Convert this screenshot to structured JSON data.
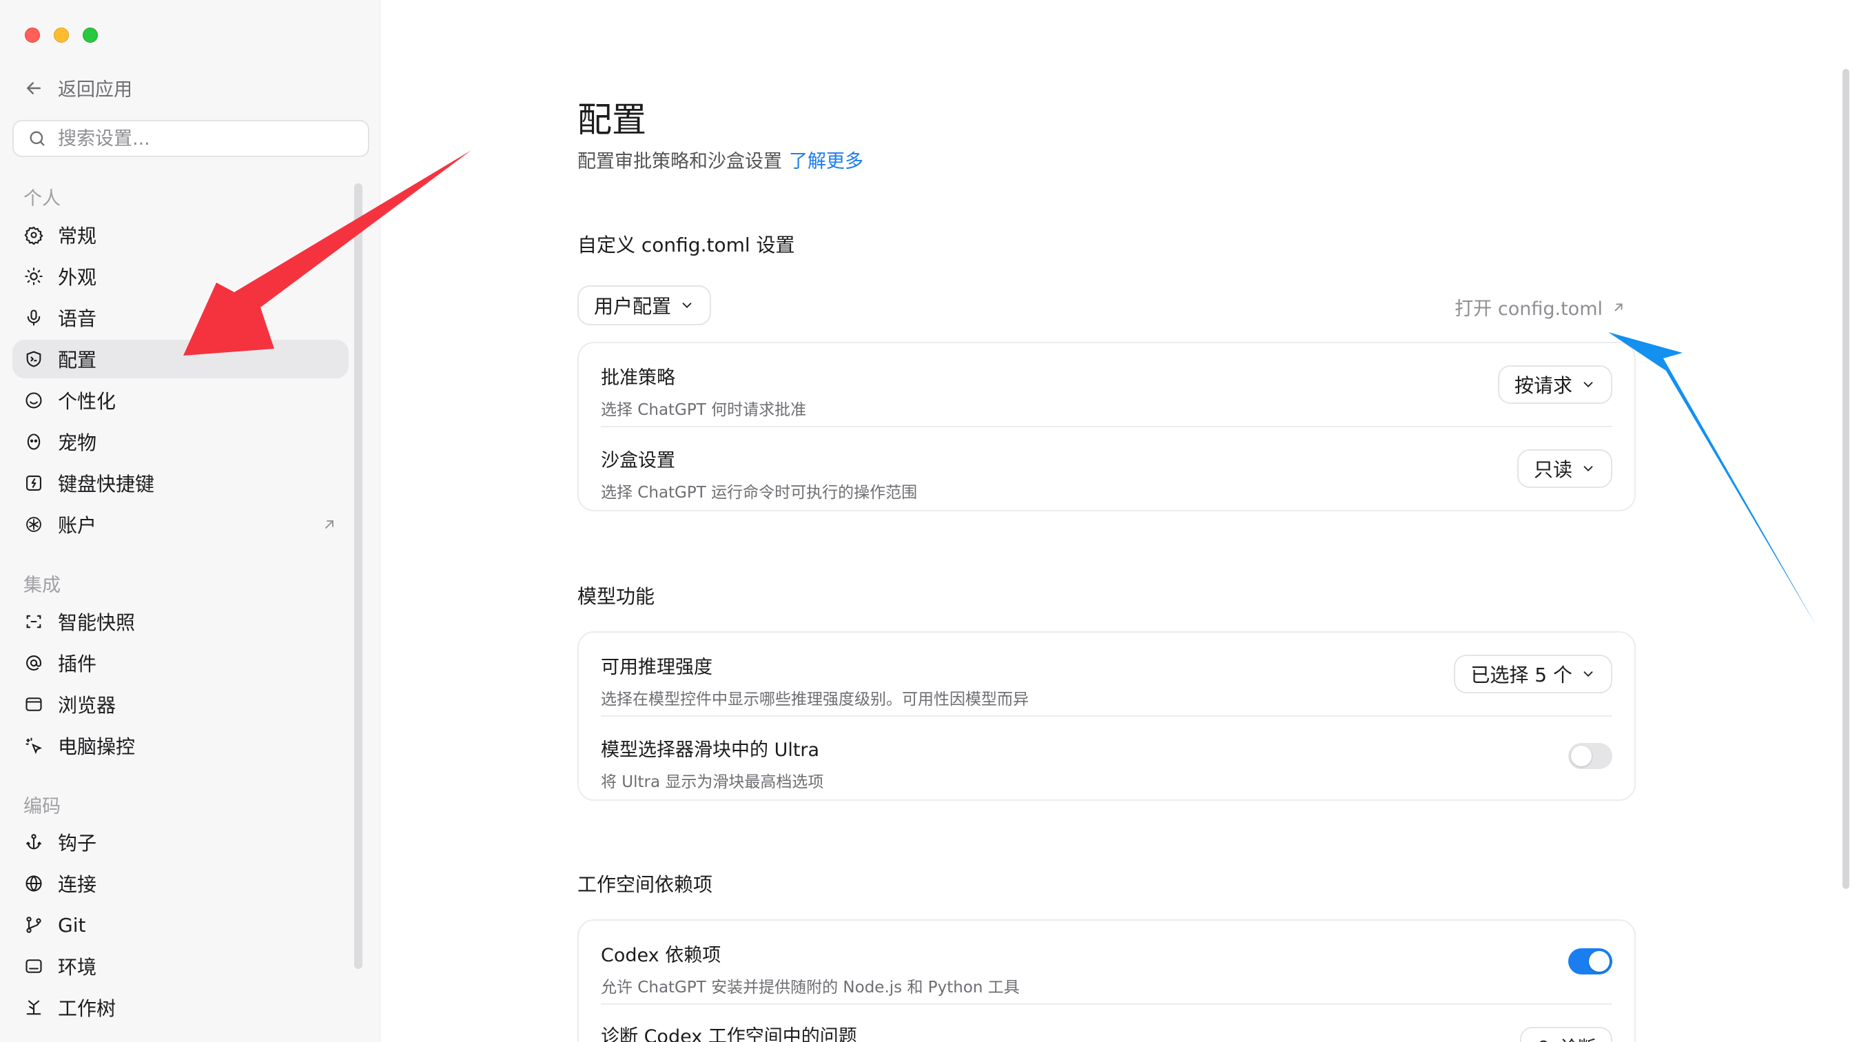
{
  "sidebar": {
    "back_label": "返回应用",
    "search_placeholder": "搜索设置...",
    "sections": {
      "personal": "个人",
      "integrations": "集成",
      "coding": "编码"
    },
    "items": [
      {
        "label": "常规",
        "icon": "gear-icon"
      },
      {
        "label": "外观",
        "icon": "sun-icon"
      },
      {
        "label": "语音",
        "icon": "microphone-icon"
      },
      {
        "label": "配置",
        "icon": "config-shield-icon",
        "active": true
      },
      {
        "label": "个性化",
        "icon": "smile-icon"
      },
      {
        "label": "宠物",
        "icon": "pet-icon"
      },
      {
        "label": "键盘快捷键",
        "icon": "keyboard-shortcut-icon"
      },
      {
        "label": "账户",
        "icon": "openai-icon",
        "external": true
      },
      {
        "label": "智能快照",
        "icon": "snapshot-icon"
      },
      {
        "label": "插件",
        "icon": "plugin-at-icon"
      },
      {
        "label": "浏览器",
        "icon": "browser-icon"
      },
      {
        "label": "电脑操控",
        "icon": "cursor-sparkle-icon"
      },
      {
        "label": "钩子",
        "icon": "anchor-icon"
      },
      {
        "label": "连接",
        "icon": "globe-icon"
      },
      {
        "label": "Git",
        "icon": "git-branch-icon"
      },
      {
        "label": "环境",
        "icon": "terminal-icon"
      },
      {
        "label": "工作树",
        "icon": "worktree-icon"
      }
    ]
  },
  "main": {
    "title": "配置",
    "description": "配置审批策略和沙盒设置",
    "learn_more": "了解更多",
    "custom_section_title": "自定义 config.toml 设置",
    "profile_dropdown": "用户配置",
    "open_config_link": "打开 config.toml",
    "approval": {
      "title": "批准策略",
      "subtitle": "选择 ChatGPT 何时请求批准",
      "value": "按请求"
    },
    "sandbox": {
      "title": "沙盒设置",
      "subtitle": "选择 ChatGPT 运行命令时可执行的操作范围",
      "value": "只读"
    },
    "model_section_title": "模型功能",
    "reasoning": {
      "title": "可用推理强度",
      "subtitle": "选择在模型控件中显示哪些推理强度级别。可用性因模型而异",
      "value": "已选择 5 个"
    },
    "ultra": {
      "title": "模型选择器滑块中的 Ultra",
      "subtitle": "将 Ultra 显示为滑块最高档选项",
      "enabled": false
    },
    "workspace_section_title": "工作空间依赖项",
    "codex_deps": {
      "title": "Codex 依赖项",
      "subtitle": "允许 ChatGPT 安装并提供随附的 Node.js 和 Python 工具",
      "enabled": true
    },
    "diagnose": {
      "title": "诊断 Codex 工作空间中的问题",
      "button": "诊断"
    }
  },
  "colors": {
    "accent": "#1a7ef0",
    "annotation_red": "#f5333f",
    "annotation_blue": "#1390f0"
  }
}
